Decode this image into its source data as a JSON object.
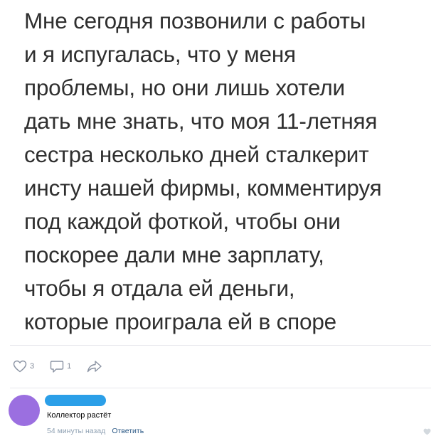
{
  "post": {
    "lines": [
      "Мне сегодня позвонили с работы",
      "и я испугалась, что у меня",
      "проблемы, но они лишь хотели",
      "дать мне знать, что моя 11-летняя",
      "сестра несколько дней сталкерит",
      "инсту нашей фирмы, комментируя",
      "под каждой фоткой, чтобы они",
      "поскорее дали мне зарплату,",
      "чтобы я отдала ей деньги,",
      "которые проиграла ей в споре"
    ]
  },
  "actions": {
    "likes": {
      "icon": "heart-outline-icon",
      "count": "3"
    },
    "comments": {
      "icon": "comment-bubble-icon",
      "count": "1"
    },
    "share": {
      "icon": "share-arrow-icon"
    }
  },
  "comment": {
    "avatar_color": "#9b6fe0",
    "redaction_color": "#2b9fe8",
    "text": "Коллектор растёт",
    "time": "54 минуты назад",
    "reply_label": "Ответить",
    "like_icon": "heart-icon"
  }
}
